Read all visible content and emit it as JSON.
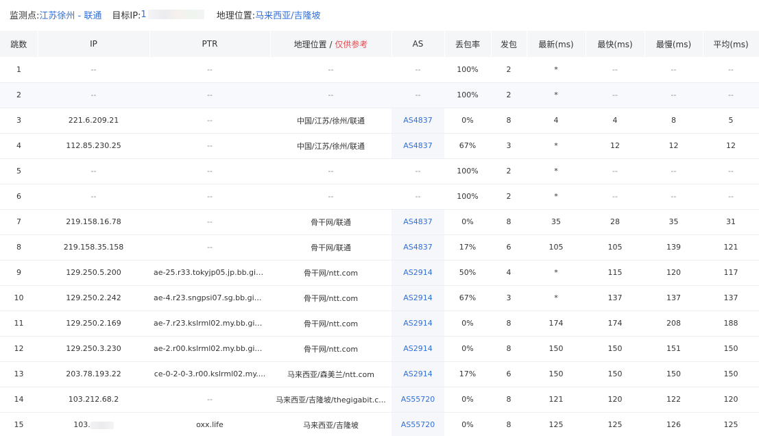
{
  "header": {
    "monitor_label": "监测点:",
    "monitor_value": "江苏徐州 - 联通",
    "target_label": "目标IP:",
    "target_value": "1",
    "geo_label": "地理位置:",
    "geo_value": "马来西亚/吉隆坡"
  },
  "columns": {
    "hop": "跳数",
    "ip": "IP",
    "ptr": "PTR",
    "geo": "地理位置",
    "geo_sep": " / ",
    "geo_ref": "仅供参考",
    "as": "AS",
    "loss": "丢包率",
    "sent": "发包",
    "latest": "最新(ms)",
    "fastest": "最快(ms)",
    "slowest": "最慢(ms)",
    "avg": "平均(ms)"
  },
  "rows": [
    {
      "hop": "1",
      "ip": "--",
      "ptr": "--",
      "geo": "--",
      "as": "--",
      "loss": "100%",
      "sent": "2",
      "latest": "*",
      "fastest": "--",
      "slowest": "--",
      "avg": "--"
    },
    {
      "hop": "2",
      "ip": "--",
      "ptr": "--",
      "geo": "--",
      "as": "--",
      "loss": "100%",
      "sent": "2",
      "latest": "*",
      "fastest": "--",
      "slowest": "--",
      "avg": "--"
    },
    {
      "hop": "3",
      "ip": "221.6.209.21",
      "ptr": "--",
      "geo": "中国/江苏/徐州/联通",
      "as": "AS4837",
      "loss": "0%",
      "sent": "8",
      "latest": "4",
      "fastest": "4",
      "slowest": "8",
      "avg": "5"
    },
    {
      "hop": "4",
      "ip": "112.85.230.25",
      "ptr": "--",
      "geo": "中国/江苏/徐州/联通",
      "as": "AS4837",
      "loss": "67%",
      "sent": "3",
      "latest": "*",
      "fastest": "12",
      "slowest": "12",
      "avg": "12"
    },
    {
      "hop": "5",
      "ip": "--",
      "ptr": "--",
      "geo": "--",
      "as": "--",
      "loss": "100%",
      "sent": "2",
      "latest": "*",
      "fastest": "--",
      "slowest": "--",
      "avg": "--"
    },
    {
      "hop": "6",
      "ip": "--",
      "ptr": "--",
      "geo": "--",
      "as": "--",
      "loss": "100%",
      "sent": "2",
      "latest": "*",
      "fastest": "--",
      "slowest": "--",
      "avg": "--"
    },
    {
      "hop": "7",
      "ip": "219.158.16.78",
      "ptr": "--",
      "geo": "骨干网/联通",
      "as": "AS4837",
      "loss": "0%",
      "sent": "8",
      "latest": "35",
      "fastest": "28",
      "slowest": "35",
      "avg": "31"
    },
    {
      "hop": "8",
      "ip": "219.158.35.158",
      "ptr": "--",
      "geo": "骨干网/联通",
      "as": "AS4837",
      "loss": "17%",
      "sent": "6",
      "latest": "105",
      "fastest": "105",
      "slowest": "139",
      "avg": "121"
    },
    {
      "hop": "9",
      "ip": "129.250.5.200",
      "ptr": "ae-25.r33.tokyjp05.jp.bb.gin....",
      "geo": "骨干网/ntt.com",
      "as": "AS2914",
      "loss": "50%",
      "sent": "4",
      "latest": "*",
      "fastest": "115",
      "slowest": "120",
      "avg": "117"
    },
    {
      "hop": "10",
      "ip": "129.250.2.242",
      "ptr": "ae-4.r23.sngpsi07.sg.bb.gin....",
      "geo": "骨干网/ntt.com",
      "as": "AS2914",
      "loss": "67%",
      "sent": "3",
      "latest": "*",
      "fastest": "137",
      "slowest": "137",
      "avg": "137"
    },
    {
      "hop": "11",
      "ip": "129.250.2.169",
      "ptr": "ae-7.r23.kslrml02.my.bb.gin.n...",
      "geo": "骨干网/ntt.com",
      "as": "AS2914",
      "loss": "0%",
      "sent": "8",
      "latest": "174",
      "fastest": "174",
      "slowest": "208",
      "avg": "188"
    },
    {
      "hop": "12",
      "ip": "129.250.3.230",
      "ptr": "ae-2.r00.kslrml02.my.bb.gin....",
      "geo": "骨干网/ntt.com",
      "as": "AS2914",
      "loss": "0%",
      "sent": "8",
      "latest": "150",
      "fastest": "150",
      "slowest": "151",
      "avg": "150"
    },
    {
      "hop": "13",
      "ip": "203.78.193.22",
      "ptr": "ce-0-2-0-3.r00.kslrml02.my....",
      "geo": "马来西亚/森美兰/ntt.com",
      "as": "AS2914",
      "loss": "17%",
      "sent": "6",
      "latest": "150",
      "fastest": "150",
      "slowest": "150",
      "avg": "150"
    },
    {
      "hop": "14",
      "ip": "103.212.68.2",
      "ptr": "--",
      "geo": "马来西亚/吉隆坡/thegigabit.c...",
      "as": "AS55720",
      "loss": "0%",
      "sent": "8",
      "latest": "121",
      "fastest": "120",
      "slowest": "122",
      "avg": "120"
    },
    {
      "hop": "15",
      "ip": "103.",
      "ptr": "oxx.life",
      "geo": "马来西亚/吉隆坡",
      "as": "AS55720",
      "loss": "0%",
      "sent": "8",
      "latest": "125",
      "fastest": "125",
      "slowest": "126",
      "avg": "125"
    }
  ]
}
